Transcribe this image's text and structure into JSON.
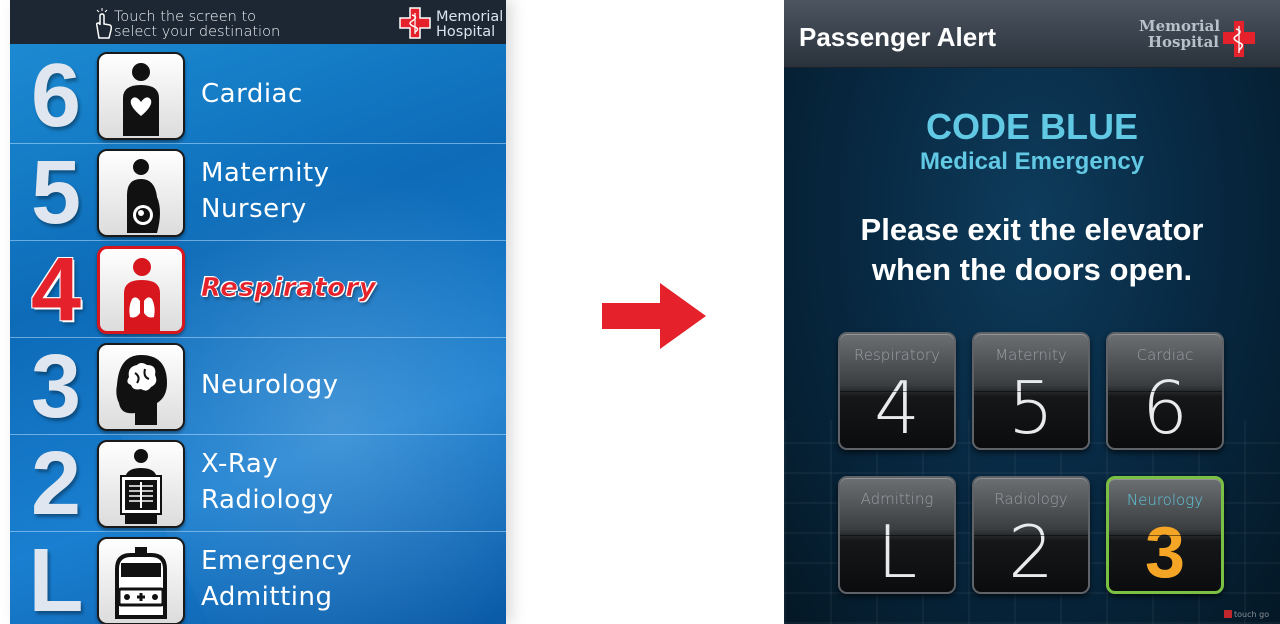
{
  "left_panel": {
    "instruction_line1": "Touch the screen to",
    "instruction_line2": "select your destination",
    "logo_line1": "Memorial",
    "logo_line2": "Hospital",
    "floors": [
      {
        "number": "6",
        "label_line1": "Cardiac",
        "label_line2": "",
        "icon": "heart-person-icon",
        "active": false
      },
      {
        "number": "5",
        "label_line1": "Maternity",
        "label_line2": "Nursery",
        "icon": "pregnant-person-icon",
        "active": false
      },
      {
        "number": "4",
        "label_line1": "Respiratory",
        "label_line2": "",
        "icon": "lungs-person-icon",
        "active": true
      },
      {
        "number": "3",
        "label_line1": "Neurology",
        "label_line2": "",
        "icon": "brain-head-icon",
        "active": false
      },
      {
        "number": "2",
        "label_line1": "X-Ray",
        "label_line2": "Radiology",
        "icon": "xray-person-icon",
        "active": false
      },
      {
        "number": "L",
        "label_line1": "Emergency",
        "label_line2": "Admitting",
        "icon": "ambulance-icon",
        "active": false
      }
    ]
  },
  "right_panel": {
    "title": "Passenger Alert",
    "logo_line1": "Memorial",
    "logo_line2": "Hospital",
    "code_title": "CODE BLUE",
    "code_subtitle": "Medical Emergency",
    "message_line1": "Please exit the elevator",
    "message_line2": "when the doors open.",
    "buttons": [
      {
        "name": "Respiratory",
        "number": "4",
        "active": false
      },
      {
        "name": "Maternity",
        "number": "5",
        "active": false
      },
      {
        "name": "Cardiac",
        "number": "6",
        "active": false
      },
      {
        "name": "Admitting",
        "number": "L",
        "active": false
      },
      {
        "name": "Radiology",
        "number": "2",
        "active": false
      },
      {
        "name": "Neurology",
        "number": "3",
        "active": true
      }
    ],
    "watermark": "touch go"
  },
  "colors": {
    "left_bg": "#0d6bb8",
    "active_red": "#e5222b",
    "code_blue": "#62c9e4",
    "active_green": "#7ac043",
    "active_orange": "#f5a526"
  }
}
